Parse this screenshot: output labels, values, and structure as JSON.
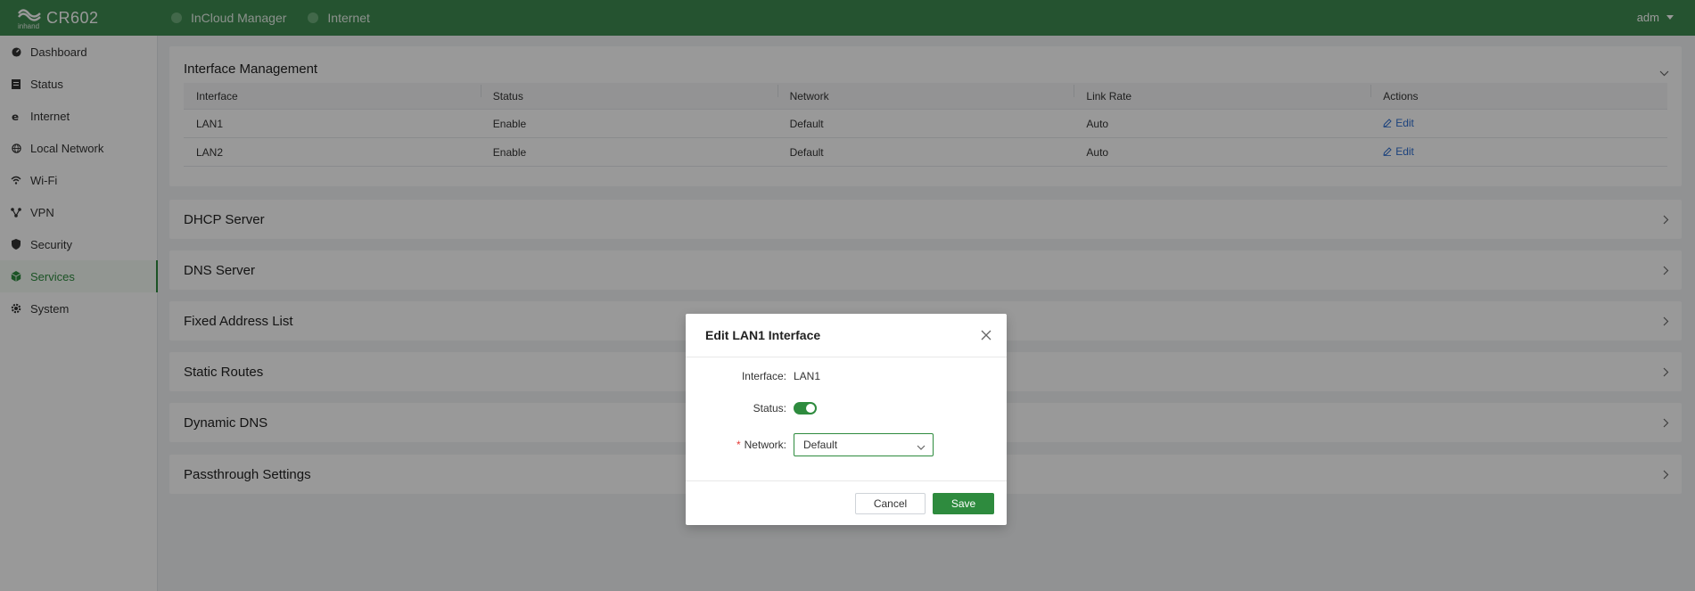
{
  "header": {
    "logo_text": "CR602",
    "logo_sub": "inhand",
    "status_items": [
      {
        "label": "InCloud Manager"
      },
      {
        "label": "Internet"
      }
    ],
    "user": "adm"
  },
  "sidebar": {
    "items": [
      {
        "label": "Dashboard",
        "icon": "dashboard-icon"
      },
      {
        "label": "Status",
        "icon": "status-icon"
      },
      {
        "label": "Internet",
        "icon": "internet-icon"
      },
      {
        "label": "Local Network",
        "icon": "globe-icon"
      },
      {
        "label": "Wi-Fi",
        "icon": "wifi-icon"
      },
      {
        "label": "VPN",
        "icon": "vpn-icon"
      },
      {
        "label": "Security",
        "icon": "shield-icon"
      },
      {
        "label": "Services",
        "icon": "services-icon",
        "active": true
      },
      {
        "label": "System",
        "icon": "gear-icon"
      }
    ]
  },
  "main": {
    "interface_management": {
      "title": "Interface Management",
      "columns": [
        "Interface",
        "Status",
        "Network",
        "Link Rate",
        "Actions"
      ],
      "rows": [
        {
          "interface": "LAN1",
          "status": "Enable",
          "network": "Default",
          "link_rate": "Auto",
          "action": "Edit"
        },
        {
          "interface": "LAN2",
          "status": "Enable",
          "network": "Default",
          "link_rate": "Auto",
          "action": "Edit"
        }
      ]
    },
    "sections": [
      {
        "title": "DHCP Server"
      },
      {
        "title": "DNS Server"
      },
      {
        "title": "Fixed Address List"
      },
      {
        "title": "Static Routes"
      },
      {
        "title": "Dynamic DNS"
      },
      {
        "title": "Passthrough Settings"
      }
    ]
  },
  "modal": {
    "title": "Edit LAN1 Interface",
    "interface_label": "Interface",
    "interface_value": "LAN1",
    "status_label": "Status",
    "status_on": true,
    "network_label": "Network",
    "network_value": "Default",
    "cancel_label": "Cancel",
    "save_label": "Save"
  },
  "colors": {
    "brand": "#3f8b50",
    "accent": "#2e8b3e",
    "link": "#2f6fd0"
  }
}
